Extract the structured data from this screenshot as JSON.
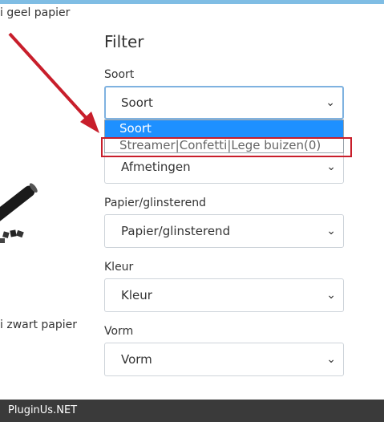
{
  "captions": {
    "top": "i geel papier",
    "bottom": "i zwart papier"
  },
  "filter": {
    "title": "Filter",
    "soort": {
      "label": "Soort",
      "value": "Soort",
      "options": [
        "Soort",
        "Streamer|Confetti|Lege buizen(0)"
      ]
    },
    "afmetingen": {
      "value": "Afmetingen"
    },
    "papier": {
      "label": "Papier/glinsterend",
      "value": "Papier/glinsterend"
    },
    "kleur": {
      "label": "Kleur",
      "value": "Kleur"
    },
    "vorm": {
      "label": "Vorm",
      "value": "Vorm"
    }
  },
  "footer": {
    "text": "PluginUs.NET"
  },
  "colors": {
    "accent": "#1e90ff",
    "highlight": "#c81e2b",
    "topbar": "#7fbde4",
    "footer_bg": "#3a3a3a"
  }
}
